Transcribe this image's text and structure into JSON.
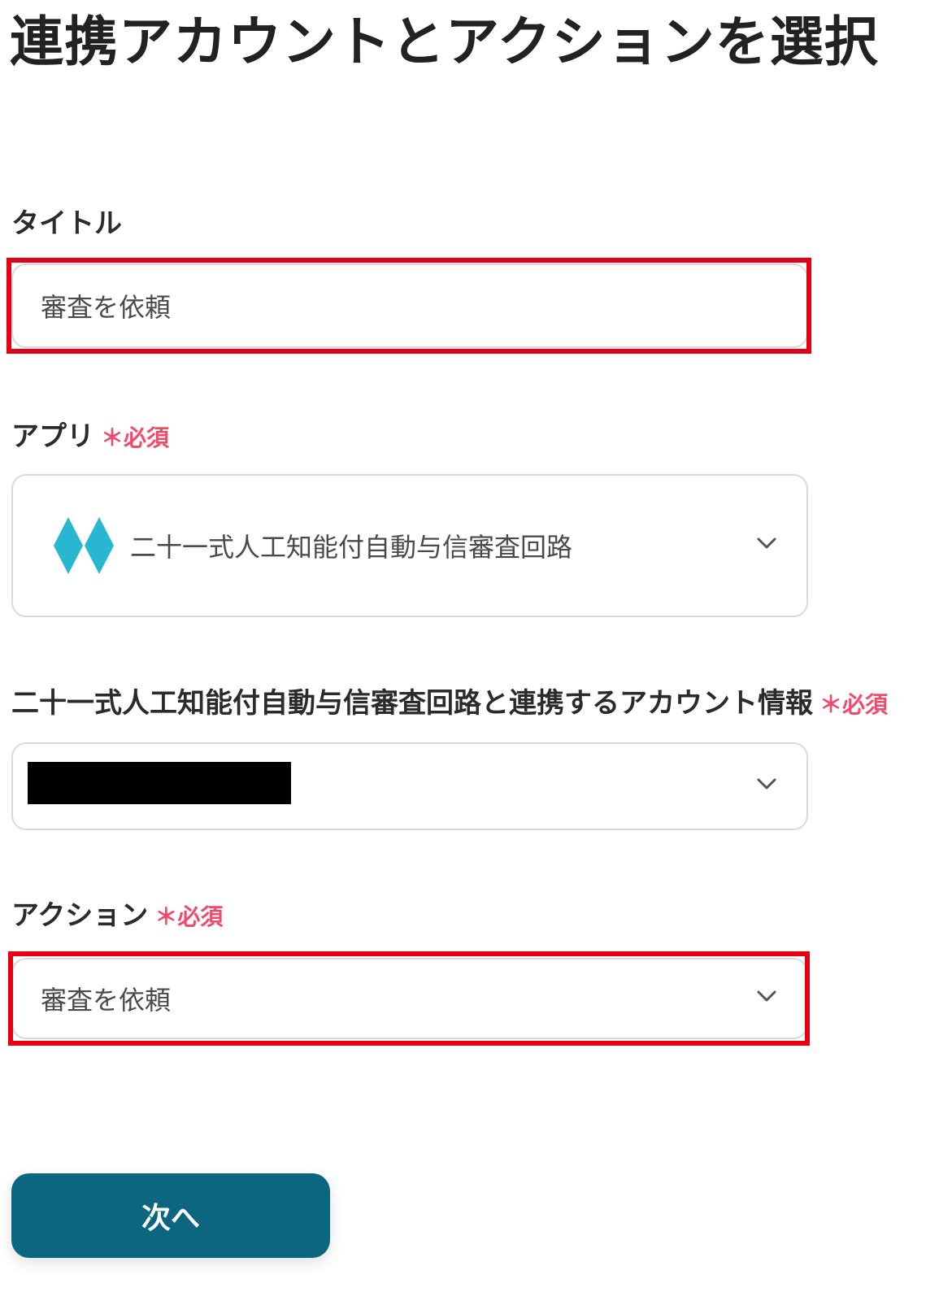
{
  "page": {
    "title": "連携アカウントとアクションを選択"
  },
  "title_field": {
    "label": "タイトル",
    "value": "審査を依頼"
  },
  "app_field": {
    "label": "アプリ",
    "required_mark": "＊",
    "required_text": "必須",
    "value": "二十一式人工知能付自動与信審査回路",
    "icon": "diamond-logo-icon"
  },
  "account_field": {
    "label": "二十一式人工知能付自動与信審査回路と連携するアカウント情報",
    "required_mark": "＊",
    "required_text": "必須",
    "value_redacted": true
  },
  "action_field": {
    "label": "アクション",
    "required_mark": "＊",
    "required_text": "必須",
    "value": "審査を依頼"
  },
  "next_button": {
    "label": "次へ"
  },
  "colors": {
    "highlight": "#e60012",
    "required": "#ef4b6b",
    "button": "#0d6680",
    "logo": "#29b6d1"
  }
}
